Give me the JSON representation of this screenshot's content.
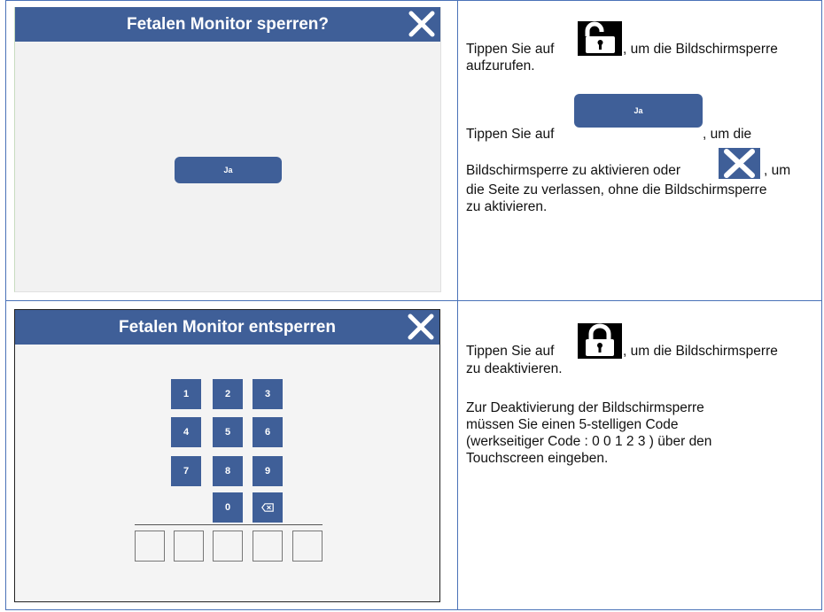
{
  "colors": {
    "header_blue": "#3f5f98",
    "table_border": "#4a72b8",
    "panel_bg": "#f2f2f2"
  },
  "lock_screen_dialog": {
    "title": "Fetalen Monitor sperren?",
    "close_icon": "close-x-icon",
    "ja_label": "Ja"
  },
  "unlock_screen_dialog": {
    "title": "Fetalen Monitor entsperren",
    "close_icon": "close-x-icon",
    "keys": [
      "1",
      "2",
      "3",
      "4",
      "5",
      "6",
      "7",
      "8",
      "9",
      "0"
    ],
    "backspace_icon": "backspace-icon",
    "code_slots": 5
  },
  "instructions_lock": {
    "line1_a": "Tippen Sie auf",
    "line1_b": ", um die Bildschirmsperre",
    "line2": "aufzurufen.",
    "line3_a": "Tippen Sie auf",
    "inline_ja": "Ja",
    "line3_b": ", um die",
    "line4_a": "Bildschirmsperre zu aktivieren oder",
    "line4_b": ", um",
    "line5": "die Seite zu verlassen, ohne die Bildschirmsperre",
    "line6": "zu aktivieren."
  },
  "instructions_unlock": {
    "line1_a": "Tippen Sie auf",
    "line1_b": ", um die Bildschirmsperre",
    "line2": "zu deaktivieren.",
    "line3": "Zur Deaktivierung der Bildschirmsperre",
    "line4": "müssen Sie einen 5-stelligen Code",
    "line5": "(werkseitiger Code : 0 0 1 2 3 ) über den",
    "line6": "Touchscreen eingeben."
  }
}
